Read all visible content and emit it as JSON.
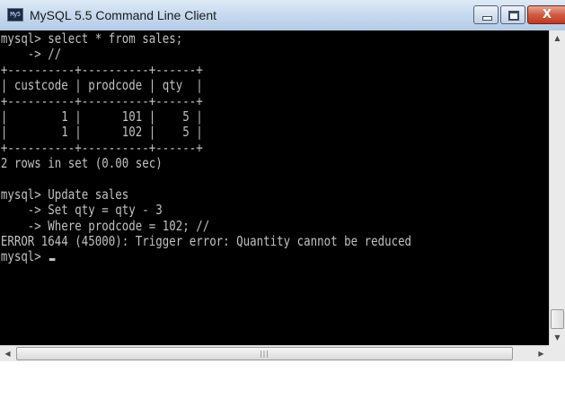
{
  "window": {
    "title": "MySQL 5.5 Command Line Client",
    "icon": "mysql-console-icon",
    "icon_text": "My5"
  },
  "title_buttons": {
    "minimize_icon": "minimize-icon",
    "maximize_icon": "maximize-icon",
    "close_icon": "close-icon",
    "close_glyph": "X"
  },
  "console": {
    "lines": [
      "mysql> select * from sales;",
      "    -> //",
      "+----------+----------+------+",
      "| custcode | prodcode | qty  |",
      "+----------+----------+------+",
      "|        1 |      101 |    5 |",
      "|        1 |      102 |    5 |",
      "+----------+----------+------+",
      "2 rows in set (0.00 sec)",
      "",
      "mysql> Update sales",
      "    -> Set qty = qty - 3",
      "    -> Where prodcode = 102; //",
      "ERROR 1644 (45000): Trigger error: Quantity cannot be reduced",
      "mysql> "
    ]
  },
  "scrollbars": {
    "vertical_up_glyph": "▲",
    "vertical_down_glyph": "▼",
    "horizontal_left_glyph": "◀",
    "horizontal_right_glyph": "▶",
    "grip_glyph": "|||"
  },
  "colors": {
    "console_bg": "#000000",
    "console_fg": "#c0c0c0",
    "close_button": "#c23a22",
    "titlebar": "#c6d9ee"
  }
}
